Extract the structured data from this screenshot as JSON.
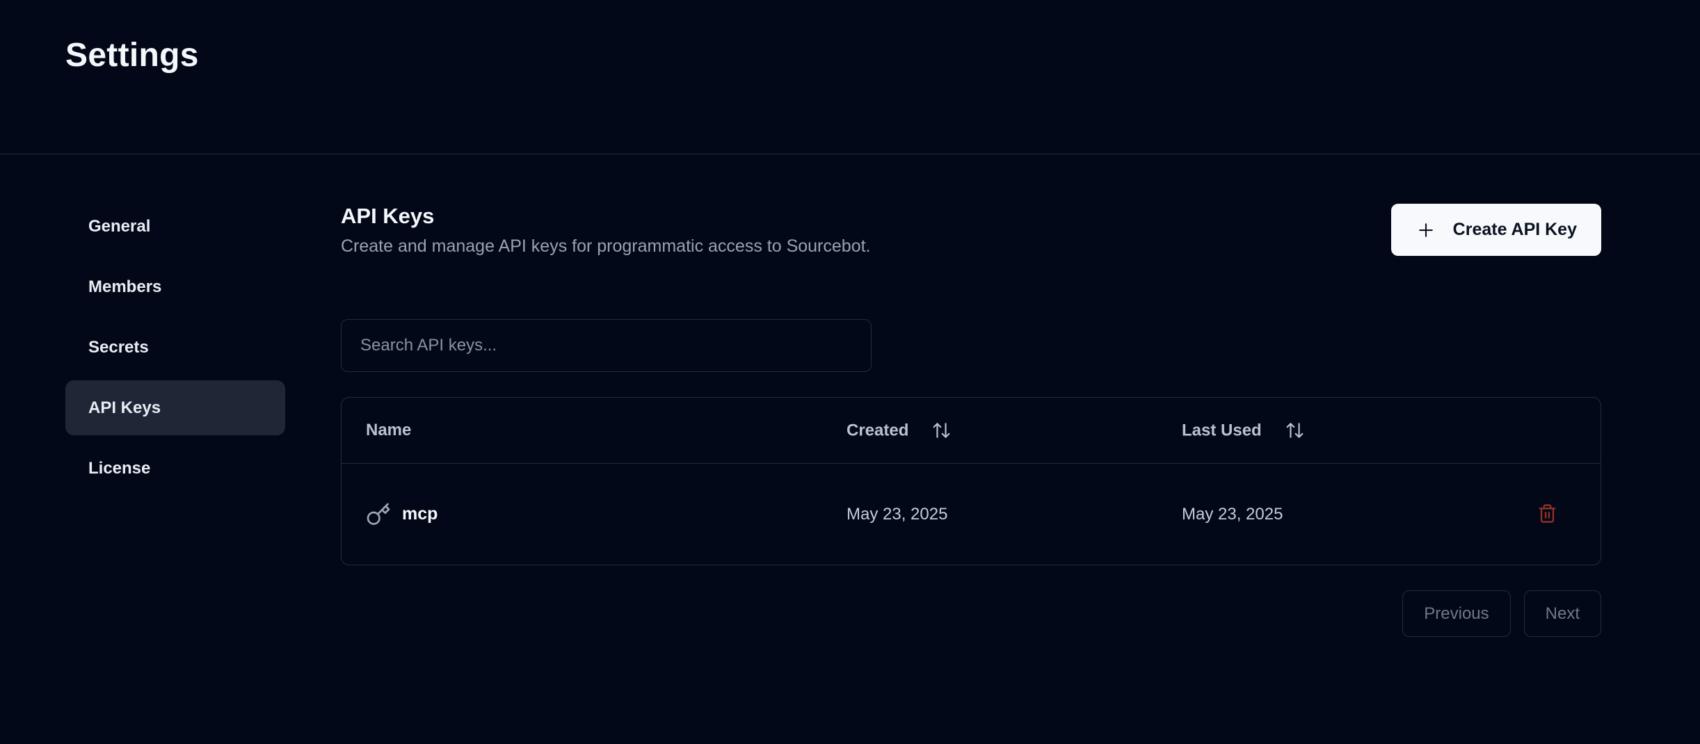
{
  "page": {
    "title": "Settings"
  },
  "sidebar": {
    "items": [
      {
        "label": "General",
        "active": false
      },
      {
        "label": "Members",
        "active": false
      },
      {
        "label": "Secrets",
        "active": false
      },
      {
        "label": "API Keys",
        "active": true
      },
      {
        "label": "License",
        "active": false
      }
    ]
  },
  "main": {
    "heading": "API Keys",
    "subheading": "Create and manage API keys for programmatic access to Sourcebot.",
    "create_button": {
      "label": "Create API Key",
      "icon": "plus-icon"
    },
    "search": {
      "placeholder": "Search API keys...",
      "value": ""
    },
    "table": {
      "columns": [
        {
          "label": "Name",
          "sortable": false
        },
        {
          "label": "Created",
          "sortable": true,
          "icon": "arrow-up-down-icon"
        },
        {
          "label": "Last Used",
          "sortable": true,
          "icon": "arrow-up-down-icon"
        }
      ],
      "rows": [
        {
          "icon": "key-icon",
          "name": "mcp",
          "created": "May 23, 2025",
          "last_used": "May 23, 2025",
          "action_icon": "trash-icon"
        }
      ]
    },
    "pagination": {
      "previous": "Previous",
      "next": "Next"
    }
  },
  "colors": {
    "background": "#020817",
    "border": "#232c3d",
    "text_primary": "#f4f7fb",
    "text_muted": "#98a2b3",
    "table_header_text": "#b9c2d0",
    "table_cell_text": "#c3cbd8",
    "active_nav_bg": "#1f2737",
    "primary_button_bg": "#f7f9fc",
    "primary_button_text": "#0b1220",
    "destructive": "#963128",
    "pagination_text": "#6f7888"
  }
}
